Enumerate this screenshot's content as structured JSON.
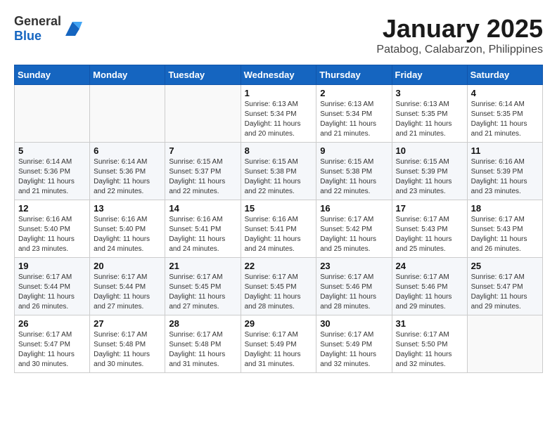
{
  "logo": {
    "text_general": "General",
    "text_blue": "Blue"
  },
  "header": {
    "month": "January 2025",
    "location": "Patabog, Calabarzon, Philippines"
  },
  "weekdays": [
    "Sunday",
    "Monday",
    "Tuesday",
    "Wednesday",
    "Thursday",
    "Friday",
    "Saturday"
  ],
  "weeks": [
    [
      {
        "day": null
      },
      {
        "day": null
      },
      {
        "day": null
      },
      {
        "day": "1",
        "sunrise": "6:13 AM",
        "sunset": "5:34 PM",
        "daylight": "11 hours and 20 minutes."
      },
      {
        "day": "2",
        "sunrise": "6:13 AM",
        "sunset": "5:34 PM",
        "daylight": "11 hours and 21 minutes."
      },
      {
        "day": "3",
        "sunrise": "6:13 AM",
        "sunset": "5:35 PM",
        "daylight": "11 hours and 21 minutes."
      },
      {
        "day": "4",
        "sunrise": "6:14 AM",
        "sunset": "5:35 PM",
        "daylight": "11 hours and 21 minutes."
      }
    ],
    [
      {
        "day": "5",
        "sunrise": "6:14 AM",
        "sunset": "5:36 PM",
        "daylight": "11 hours and 21 minutes."
      },
      {
        "day": "6",
        "sunrise": "6:14 AM",
        "sunset": "5:36 PM",
        "daylight": "11 hours and 22 minutes."
      },
      {
        "day": "7",
        "sunrise": "6:15 AM",
        "sunset": "5:37 PM",
        "daylight": "11 hours and 22 minutes."
      },
      {
        "day": "8",
        "sunrise": "6:15 AM",
        "sunset": "5:38 PM",
        "daylight": "11 hours and 22 minutes."
      },
      {
        "day": "9",
        "sunrise": "6:15 AM",
        "sunset": "5:38 PM",
        "daylight": "11 hours and 22 minutes."
      },
      {
        "day": "10",
        "sunrise": "6:15 AM",
        "sunset": "5:39 PM",
        "daylight": "11 hours and 23 minutes."
      },
      {
        "day": "11",
        "sunrise": "6:16 AM",
        "sunset": "5:39 PM",
        "daylight": "11 hours and 23 minutes."
      }
    ],
    [
      {
        "day": "12",
        "sunrise": "6:16 AM",
        "sunset": "5:40 PM",
        "daylight": "11 hours and 23 minutes."
      },
      {
        "day": "13",
        "sunrise": "6:16 AM",
        "sunset": "5:40 PM",
        "daylight": "11 hours and 24 minutes."
      },
      {
        "day": "14",
        "sunrise": "6:16 AM",
        "sunset": "5:41 PM",
        "daylight": "11 hours and 24 minutes."
      },
      {
        "day": "15",
        "sunrise": "6:16 AM",
        "sunset": "5:41 PM",
        "daylight": "11 hours and 24 minutes."
      },
      {
        "day": "16",
        "sunrise": "6:17 AM",
        "sunset": "5:42 PM",
        "daylight": "11 hours and 25 minutes."
      },
      {
        "day": "17",
        "sunrise": "6:17 AM",
        "sunset": "5:43 PM",
        "daylight": "11 hours and 25 minutes."
      },
      {
        "day": "18",
        "sunrise": "6:17 AM",
        "sunset": "5:43 PM",
        "daylight": "11 hours and 26 minutes."
      }
    ],
    [
      {
        "day": "19",
        "sunrise": "6:17 AM",
        "sunset": "5:44 PM",
        "daylight": "11 hours and 26 minutes."
      },
      {
        "day": "20",
        "sunrise": "6:17 AM",
        "sunset": "5:44 PM",
        "daylight": "11 hours and 27 minutes."
      },
      {
        "day": "21",
        "sunrise": "6:17 AM",
        "sunset": "5:45 PM",
        "daylight": "11 hours and 27 minutes."
      },
      {
        "day": "22",
        "sunrise": "6:17 AM",
        "sunset": "5:45 PM",
        "daylight": "11 hours and 28 minutes."
      },
      {
        "day": "23",
        "sunrise": "6:17 AM",
        "sunset": "5:46 PM",
        "daylight": "11 hours and 28 minutes."
      },
      {
        "day": "24",
        "sunrise": "6:17 AM",
        "sunset": "5:46 PM",
        "daylight": "11 hours and 29 minutes."
      },
      {
        "day": "25",
        "sunrise": "6:17 AM",
        "sunset": "5:47 PM",
        "daylight": "11 hours and 29 minutes."
      }
    ],
    [
      {
        "day": "26",
        "sunrise": "6:17 AM",
        "sunset": "5:47 PM",
        "daylight": "11 hours and 30 minutes."
      },
      {
        "day": "27",
        "sunrise": "6:17 AM",
        "sunset": "5:48 PM",
        "daylight": "11 hours and 30 minutes."
      },
      {
        "day": "28",
        "sunrise": "6:17 AM",
        "sunset": "5:48 PM",
        "daylight": "11 hours and 31 minutes."
      },
      {
        "day": "29",
        "sunrise": "6:17 AM",
        "sunset": "5:49 PM",
        "daylight": "11 hours and 31 minutes."
      },
      {
        "day": "30",
        "sunrise": "6:17 AM",
        "sunset": "5:49 PM",
        "daylight": "11 hours and 32 minutes."
      },
      {
        "day": "31",
        "sunrise": "6:17 AM",
        "sunset": "5:50 PM",
        "daylight": "11 hours and 32 minutes."
      },
      {
        "day": null
      }
    ]
  ],
  "labels": {
    "sunrise": "Sunrise:",
    "sunset": "Sunset:",
    "daylight": "Daylight:"
  }
}
